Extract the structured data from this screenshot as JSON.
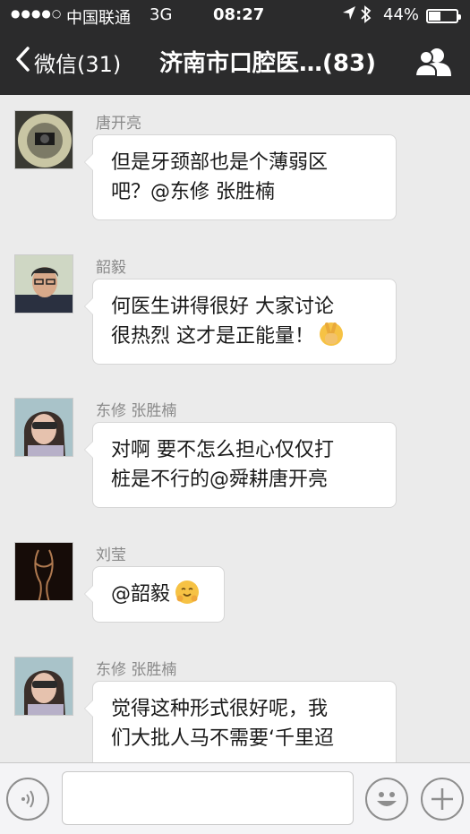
{
  "status_bar": {
    "signal": "●●●●○",
    "carrier": "中国联通",
    "network": "3G",
    "time": "08:27",
    "location_icon": "location-arrow-icon",
    "bluetooth_icon": "bluetooth-icon",
    "battery_percent": "44%",
    "battery_level": 0.44
  },
  "nav": {
    "back_label": "微信(31)",
    "title": "济南市口腔医…(83)",
    "group_icon": "group-members-icon"
  },
  "messages": [
    {
      "sender": "唐开亮",
      "lines": [
        "但是牙颈部也是个薄弱区",
        "吧？@东修 张胜楠"
      ],
      "emoji": null
    },
    {
      "sender": "韶毅",
      "lines": [
        "何医生讲得很好 大家讨论",
        "很热烈 这才是正能量！"
      ],
      "emoji": "victory-hand-emoji"
    },
    {
      "sender": "东修 张胜楠",
      "lines": [
        "对啊 要不怎么担心仅仅打",
        "桩是不行的@舜耕唐开亮"
      ],
      "emoji": null
    },
    {
      "sender": "刘莹",
      "lines": [
        "@韶毅"
      ],
      "emoji": "hugging-face-emoji"
    },
    {
      "sender": "东修 张胜楠",
      "lines": [
        "觉得这种形式很好呢，我",
        "们大批人马不需要‘千里迢"
      ],
      "emoji": null
    }
  ],
  "input_bar": {
    "voice_icon": "voice-input-icon",
    "emoji_icon": "emoji-icon",
    "plus_icon": "plus-icon",
    "text_value": ""
  }
}
